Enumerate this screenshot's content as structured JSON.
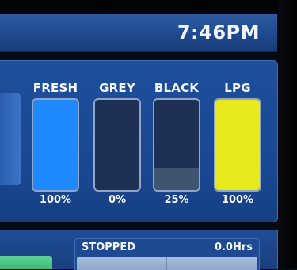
{
  "header": {
    "time": "7:46PM"
  },
  "tanks": [
    {
      "label": "FRESH",
      "percent_text": "100%",
      "level": 1.0,
      "fill_color": "#1e88ff",
      "fill_name": "fresh-tank-fill"
    },
    {
      "label": "GREY",
      "percent_text": "0%",
      "level": 0.0,
      "fill_color": "#1e3154",
      "fill_name": "grey-tank-fill"
    },
    {
      "label": "BLACK",
      "percent_text": "25%",
      "level": 0.25,
      "fill_color": "#3e546f",
      "fill_name": "black-tank-fill"
    },
    {
      "label": "LPG",
      "percent_text": "100%",
      "level": 1.0,
      "fill_color": "#e6ea1c",
      "fill_name": "lpg-tank-fill"
    }
  ],
  "status": {
    "state": "STOPPED",
    "hours": "0.0Hrs"
  },
  "colors": {
    "panel_blue": "#1e4f9b",
    "fresh_blue": "#1e88ff",
    "lpg_yellow": "#e6ea1c",
    "button_green": "#4cc585"
  }
}
